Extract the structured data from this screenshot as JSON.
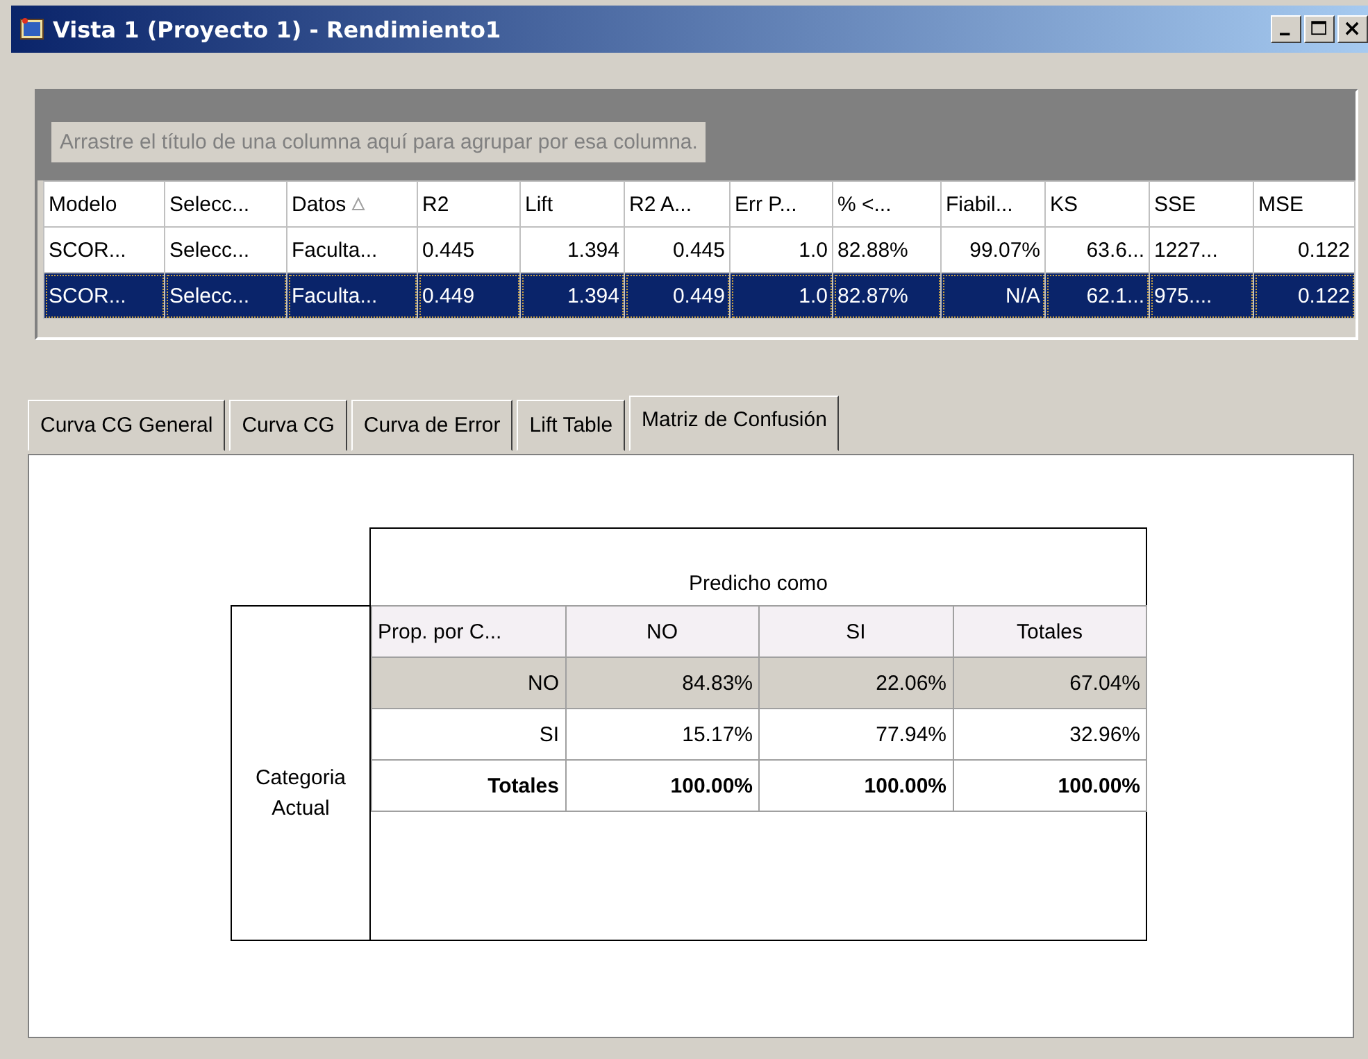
{
  "window": {
    "title": "Vista 1 (Proyecto 1) - Rendimiento1"
  },
  "grid": {
    "group_prompt": "Arrastre el título de una columna aquí para agrupar por esa columna.",
    "columns": [
      {
        "label": "Modelo",
        "kind": "text",
        "sorted": false
      },
      {
        "label": "Selecc...",
        "kind": "text",
        "sorted": false
      },
      {
        "label": "Datos",
        "kind": "text",
        "sorted": true
      },
      {
        "label": "R2",
        "kind": "text",
        "sorted": false
      },
      {
        "label": "Lift",
        "kind": "number",
        "sorted": false
      },
      {
        "label": "R2 A...",
        "kind": "number",
        "sorted": false
      },
      {
        "label": "Err P...",
        "kind": "number",
        "sorted": false
      },
      {
        "label": "% <...",
        "kind": "text",
        "sorted": false
      },
      {
        "label": "Fiabil...",
        "kind": "number",
        "sorted": false
      },
      {
        "label": "KS",
        "kind": "number",
        "sorted": false
      },
      {
        "label": "SSE",
        "kind": "text",
        "sorted": false
      },
      {
        "label": "MSE",
        "kind": "number",
        "sorted": false
      }
    ],
    "rows": [
      {
        "selected": false,
        "cells": [
          "SCOR...",
          "Selecc...",
          "Faculta...",
          "0.445",
          "1.394",
          "0.445",
          "1.0",
          "82.88%",
          "99.07%",
          "63.6...",
          "1227...",
          "0.122"
        ]
      },
      {
        "selected": true,
        "cells": [
          "SCOR...",
          "Selecc...",
          "Faculta...",
          "0.449",
          "1.394",
          "0.449",
          "1.0",
          "82.87%",
          "N/A",
          "62.1...",
          "975....",
          "0.122"
        ]
      }
    ]
  },
  "tabs": [
    {
      "label": "Curva CG General",
      "selected": false
    },
    {
      "label": "Curva CG",
      "selected": false
    },
    {
      "label": "Curva de Error",
      "selected": false
    },
    {
      "label": "Lift Table",
      "selected": false
    },
    {
      "label": "Matriz de Confusión",
      "selected": true
    }
  ],
  "matrix": {
    "title": "Predicho como",
    "row_header": "Categoria Actual",
    "columns": [
      "Prop. por C...",
      "NO",
      "SI",
      "Totales"
    ],
    "rows": [
      {
        "kind": "plain",
        "selected": true,
        "cells": [
          "NO",
          "84.83%",
          "22.06%",
          "67.04%"
        ]
      },
      {
        "kind": "plain",
        "selected": false,
        "cells": [
          "SI",
          "15.17%",
          "77.94%",
          "32.96%"
        ]
      },
      {
        "kind": "total",
        "selected": false,
        "cells": [
          "Totales",
          "100.00%",
          "100.00%",
          "100.00%"
        ]
      }
    ]
  }
}
